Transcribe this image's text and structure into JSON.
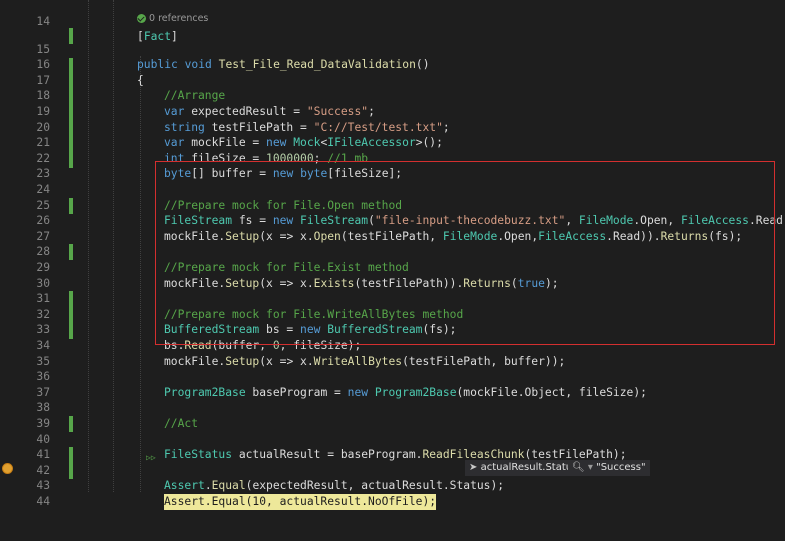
{
  "lines": [
    {
      "num": "14",
      "code": "[Fact]"
    },
    {
      "num": "15",
      "code": "public void Test_File_Read_DataValidation()"
    },
    {
      "num": "16",
      "code": "{"
    },
    {
      "num": "17",
      "code": "//Arrange"
    },
    {
      "num": "18",
      "code": "var expectedResult = \"Success\";"
    },
    {
      "num": "19",
      "code": "string testFilePath = \"C://Test/test.txt\";"
    },
    {
      "num": "20",
      "code": "var mockFile = new Mock<IFileAccessor>();"
    },
    {
      "num": "21",
      "code": "int fileSize = 1000000; //1 mb"
    },
    {
      "num": "22",
      "code": "byte[] buffer = new byte[fileSize];"
    },
    {
      "num": "23",
      "code": ""
    },
    {
      "num": "24",
      "code": "//Prepare mock for File.Open method"
    },
    {
      "num": "25",
      "code": "FileStream fs = new FileStream(\"file-input-thecodebuzz.txt\", FileMode.Open, FileAccess.Read);"
    },
    {
      "num": "26",
      "code": "mockFile.Setup(x => x.Open(testFilePath, FileMode.Open,FileAccess.Read)).Returns(fs);"
    },
    {
      "num": "27",
      "code": ""
    },
    {
      "num": "28",
      "code": "//Prepare mock for File.Exist method"
    },
    {
      "num": "29",
      "code": "mockFile.Setup(x => x.Exists(testFilePath)).Returns(true);"
    },
    {
      "num": "30",
      "code": ""
    },
    {
      "num": "31",
      "code": "//Prepare mock for File.WriteAllBytes method"
    },
    {
      "num": "32",
      "code": "BufferedStream bs = new BufferedStream(fs);"
    },
    {
      "num": "33",
      "code": "bs.Read(buffer, 0, fileSize);"
    },
    {
      "num": "34",
      "code": "mockFile.Setup(x => x.WriteAllBytes(testFilePath, buffer));"
    },
    {
      "num": "35",
      "code": ""
    },
    {
      "num": "36",
      "code": "Program2Base baseProgram = new Program2Base(mockFile.Object, fileSize);"
    },
    {
      "num": "37",
      "code": ""
    },
    {
      "num": "38",
      "code": "//Act"
    },
    {
      "num": "39",
      "code": ""
    },
    {
      "num": "40",
      "code": "FileStatus actualResult = baseProgram.ReadFileasChunk(testFilePath);"
    },
    {
      "num": "41",
      "code": ""
    },
    {
      "num": "42",
      "code": "Assert.Equal(expectedResult, actualResult.Status);"
    },
    {
      "num": "43",
      "code": "Assert.Equal(10, actualResult.NoOfFile);"
    },
    {
      "num": "44",
      "code": ""
    }
  ],
  "codelens": {
    "references": "0 references"
  },
  "datatip": {
    "expression": "actualResult.Status",
    "value": "\"Success\"",
    "icon": "magnifier-icon"
  },
  "colors": {
    "keyword": "#569cd6",
    "type": "#4ec9b0",
    "string": "#d69d85",
    "comment": "#57a64a",
    "highlight": "#eee89a",
    "box": "#d32f2f"
  }
}
